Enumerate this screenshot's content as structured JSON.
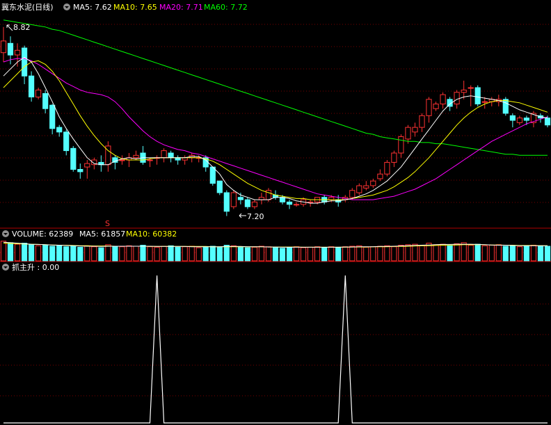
{
  "header": {
    "title": "冀东水泥(日线)",
    "ma5_label": "MA5: 7.62",
    "ma10_label": "MA10: 7.65",
    "ma20_label": "MA20: 7.71",
    "ma60_label": "MA60: 7.72"
  },
  "volume_header": {
    "volume_label": "VOLUME: 62389",
    "ma5_label": "MA5: 61857",
    "ma10_label": "MA10: 60382"
  },
  "indicator_header": {
    "label": "抓主升 : 0.00"
  },
  "annotations": {
    "high": "8.82",
    "low": "7.20",
    "marker": "S"
  },
  "colors": {
    "background": "#000000",
    "up": "#ff3232",
    "down": "#54ffff",
    "ma5": "#ffffff",
    "ma10": "#ffff00",
    "ma20": "#ff00ff",
    "ma60": "#00ff00",
    "grid": "#7a0000",
    "separator": "#b00000",
    "indicator": "#ffffff",
    "marker": "#ff3232"
  },
  "chart_data": [
    {
      "type": "candlestick",
      "title": "冀东水泥(日线)",
      "ylim": [
        7.12,
        8.92
      ],
      "grid": true,
      "candles": [
        [
          8.6,
          8.7,
          8.52,
          8.82
        ],
        [
          8.68,
          8.58,
          8.5,
          8.74
        ],
        [
          8.58,
          8.62,
          8.48,
          8.68
        ],
        [
          8.64,
          8.4,
          8.33,
          8.66
        ],
        [
          8.4,
          8.22,
          8.18,
          8.44
        ],
        [
          8.22,
          8.28,
          8.2,
          8.3
        ],
        [
          8.25,
          8.12,
          8.08,
          8.28
        ],
        [
          8.15,
          7.95,
          7.9,
          8.16
        ],
        [
          7.96,
          7.92,
          7.88,
          7.98
        ],
        [
          7.92,
          7.76,
          7.72,
          7.94
        ],
        [
          7.78,
          7.6,
          7.58,
          7.8
        ],
        [
          7.6,
          7.58,
          7.52,
          7.65
        ],
        [
          7.62,
          7.65,
          7.52,
          7.68
        ],
        [
          7.64,
          7.68,
          7.6,
          7.7
        ],
        [
          7.66,
          7.64,
          7.58,
          7.72
        ],
        [
          7.64,
          7.8,
          7.58,
          7.84
        ],
        [
          7.7,
          7.66,
          7.6,
          7.72
        ],
        [
          7.68,
          7.68,
          7.64,
          7.72
        ],
        [
          7.68,
          7.7,
          7.62,
          7.74
        ],
        [
          7.7,
          7.72,
          7.68,
          7.76
        ],
        [
          7.74,
          7.66,
          7.64,
          7.8
        ],
        [
          7.68,
          7.68,
          7.62,
          7.7
        ],
        [
          7.7,
          7.7,
          7.64,
          7.72
        ],
        [
          7.7,
          7.76,
          7.66,
          7.78
        ],
        [
          7.74,
          7.7,
          7.66,
          7.76
        ],
        [
          7.7,
          7.68,
          7.64,
          7.72
        ],
        [
          7.68,
          7.7,
          7.64,
          7.72
        ],
        [
          7.7,
          7.72,
          7.66,
          7.74
        ],
        [
          7.7,
          7.7,
          7.66,
          7.72
        ],
        [
          7.7,
          7.62,
          7.58,
          7.72
        ],
        [
          7.62,
          7.48,
          7.46,
          7.62
        ],
        [
          7.5,
          7.4,
          7.38,
          7.5
        ],
        [
          7.4,
          7.24,
          7.2,
          7.42
        ],
        [
          7.28,
          7.4,
          7.26,
          7.42
        ],
        [
          7.36,
          7.34,
          7.3,
          7.4
        ],
        [
          7.34,
          7.28,
          7.26,
          7.36
        ],
        [
          7.28,
          7.32,
          7.26,
          7.34
        ],
        [
          7.34,
          7.36,
          7.3,
          7.4
        ],
        [
          7.34,
          7.42,
          7.32,
          7.44
        ],
        [
          7.38,
          7.36,
          7.34,
          7.42
        ],
        [
          7.36,
          7.32,
          7.3,
          7.38
        ],
        [
          7.32,
          7.3,
          7.26,
          7.34
        ],
        [
          7.3,
          7.3,
          7.28,
          7.32
        ],
        [
          7.3,
          7.34,
          7.28,
          7.36
        ],
        [
          7.32,
          7.32,
          7.28,
          7.34
        ],
        [
          7.32,
          7.36,
          7.3,
          7.36
        ],
        [
          7.36,
          7.32,
          7.3,
          7.38
        ],
        [
          7.34,
          7.36,
          7.32,
          7.38
        ],
        [
          7.34,
          7.32,
          7.28,
          7.38
        ],
        [
          7.34,
          7.36,
          7.32,
          7.38
        ],
        [
          7.36,
          7.42,
          7.34,
          7.44
        ],
        [
          7.4,
          7.46,
          7.38,
          7.48
        ],
        [
          7.44,
          7.46,
          7.42,
          7.5
        ],
        [
          7.46,
          7.5,
          7.44,
          7.52
        ],
        [
          7.52,
          7.56,
          7.5,
          7.6
        ],
        [
          7.56,
          7.66,
          7.54,
          7.68
        ],
        [
          7.66,
          7.74,
          7.62,
          7.76
        ],
        [
          7.74,
          7.88,
          7.7,
          7.9
        ],
        [
          7.86,
          7.96,
          7.82,
          7.98
        ],
        [
          7.92,
          7.96,
          7.88,
          8.0
        ],
        [
          7.96,
          8.06,
          7.92,
          8.08
        ],
        [
          8.06,
          8.2,
          8.0,
          8.22
        ],
        [
          8.12,
          8.16,
          8.1,
          8.18
        ],
        [
          8.16,
          8.24,
          8.12,
          8.26
        ],
        [
          8.2,
          8.14,
          8.1,
          8.22
        ],
        [
          8.16,
          8.26,
          8.12,
          8.28
        ],
        [
          8.26,
          8.28,
          8.2,
          8.36
        ],
        [
          8.3,
          8.3,
          8.14,
          8.32
        ],
        [
          8.3,
          8.16,
          8.14,
          8.32
        ],
        [
          8.18,
          8.18,
          8.12,
          8.22
        ],
        [
          8.18,
          8.2,
          8.14,
          8.22
        ],
        [
          8.18,
          8.2,
          8.14,
          8.24
        ],
        [
          8.2,
          8.08,
          8.06,
          8.22
        ],
        [
          8.06,
          8.02,
          7.96,
          8.08
        ],
        [
          8.0,
          8.04,
          7.98,
          8.06
        ],
        [
          8.04,
          8.02,
          7.98,
          8.06
        ],
        [
          8.0,
          8.08,
          7.96,
          8.1
        ],
        [
          8.06,
          8.04,
          8.0,
          8.08
        ],
        [
          8.04,
          7.98,
          7.96,
          8.06
        ]
      ],
      "ma_lines": {
        "ma5": [
          8.4,
          8.46,
          8.52,
          8.56,
          8.52,
          8.42,
          8.3,
          8.18,
          8.05,
          7.95,
          7.86,
          7.78,
          7.7,
          7.65,
          7.64,
          7.64,
          7.67,
          7.69,
          7.7,
          7.69,
          7.7,
          7.7,
          7.7,
          7.7,
          7.7,
          7.7,
          7.7,
          7.71,
          7.71,
          7.68,
          7.62,
          7.56,
          7.47,
          7.42,
          7.38,
          7.36,
          7.34,
          7.34,
          7.34,
          7.36,
          7.36,
          7.35,
          7.33,
          7.32,
          7.31,
          7.31,
          7.32,
          7.33,
          7.33,
          7.34,
          7.35,
          7.37,
          7.39,
          7.42,
          7.46,
          7.5,
          7.56,
          7.62,
          7.7,
          7.78,
          7.86,
          7.94,
          8.02,
          8.1,
          8.16,
          8.2,
          8.22,
          8.23,
          8.22,
          8.21,
          8.2,
          8.19,
          8.17,
          8.14,
          8.11,
          8.09,
          8.07,
          8.05,
          8.04
        ],
        "ma10": [
          8.3,
          8.36,
          8.42,
          8.48,
          8.52,
          8.53,
          8.5,
          8.44,
          8.36,
          8.26,
          8.16,
          8.06,
          7.97,
          7.89,
          7.82,
          7.76,
          7.72,
          7.69,
          7.68,
          7.68,
          7.68,
          7.69,
          7.7,
          7.7,
          7.7,
          7.7,
          7.7,
          7.7,
          7.7,
          7.69,
          7.67,
          7.64,
          7.6,
          7.56,
          7.52,
          7.48,
          7.45,
          7.42,
          7.4,
          7.38,
          7.37,
          7.36,
          7.35,
          7.35,
          7.34,
          7.34,
          7.34,
          7.34,
          7.34,
          7.34,
          7.35,
          7.36,
          7.37,
          7.38,
          7.4,
          7.42,
          7.45,
          7.49,
          7.53,
          7.58,
          7.64,
          7.7,
          7.77,
          7.84,
          7.91,
          7.98,
          8.04,
          8.09,
          8.13,
          8.16,
          8.18,
          8.19,
          8.19,
          8.18,
          8.17,
          8.15,
          8.13,
          8.11,
          8.09
        ],
        "ma20": [
          8.52,
          8.54,
          8.55,
          8.55,
          8.53,
          8.5,
          8.46,
          8.42,
          8.38,
          8.34,
          8.31,
          8.28,
          8.26,
          8.25,
          8.24,
          8.22,
          8.18,
          8.12,
          8.05,
          7.99,
          7.93,
          7.88,
          7.84,
          7.81,
          7.79,
          7.77,
          7.76,
          7.74,
          7.73,
          7.71,
          7.69,
          7.67,
          7.65,
          7.63,
          7.61,
          7.59,
          7.57,
          7.55,
          7.53,
          7.51,
          7.49,
          7.47,
          7.45,
          7.43,
          7.41,
          7.39,
          7.38,
          7.37,
          7.36,
          7.35,
          7.34,
          7.34,
          7.34,
          7.34,
          7.35,
          7.36,
          7.37,
          7.39,
          7.41,
          7.43,
          7.46,
          7.49,
          7.52,
          7.56,
          7.6,
          7.64,
          7.68,
          7.72,
          7.76,
          7.8,
          7.84,
          7.87,
          7.9,
          7.93,
          7.96,
          7.99,
          8.01,
          8.03,
          8.05
        ],
        "ma60": [
          8.88,
          8.87,
          8.86,
          8.85,
          8.84,
          8.83,
          8.82,
          8.8,
          8.79,
          8.77,
          8.75,
          8.73,
          8.71,
          8.69,
          8.67,
          8.65,
          8.63,
          8.61,
          8.59,
          8.57,
          8.55,
          8.53,
          8.51,
          8.49,
          8.47,
          8.45,
          8.43,
          8.41,
          8.39,
          8.37,
          8.35,
          8.33,
          8.31,
          8.29,
          8.27,
          8.25,
          8.23,
          8.21,
          8.19,
          8.17,
          8.15,
          8.13,
          8.11,
          8.09,
          8.07,
          8.05,
          8.03,
          8.01,
          7.99,
          7.97,
          7.95,
          7.93,
          7.91,
          7.9,
          7.88,
          7.87,
          7.86,
          7.85,
          7.84,
          7.84,
          7.83,
          7.83,
          7.82,
          7.82,
          7.81,
          7.8,
          7.79,
          7.78,
          7.77,
          7.76,
          7.75,
          7.74,
          7.73,
          7.73,
          7.72,
          7.72,
          7.72,
          7.72,
          7.72
        ]
      }
    },
    {
      "type": "bar",
      "title": "VOLUME: 62389",
      "ylim": [
        0,
        80000
      ],
      "values": [
        78000,
        72000,
        66000,
        70000,
        64000,
        60000,
        62000,
        58000,
        60000,
        56000,
        58000,
        54000,
        60000,
        56000,
        52000,
        64000,
        58000,
        56000,
        60000,
        58000,
        62000,
        56000,
        54000,
        58000,
        60000,
        54000,
        56000,
        58000,
        52000,
        56000,
        58000,
        54000,
        62000,
        60000,
        56000,
        52000,
        54000,
        58000,
        56000,
        52000,
        50000,
        54000,
        56000,
        52000,
        54000,
        56000,
        52000,
        56000,
        54000,
        56000,
        58000,
        60000,
        54000,
        56000,
        58000,
        60000,
        56000,
        62000,
        64000,
        66000,
        60000,
        70000,
        64000,
        66000,
        60000,
        68000,
        72000,
        62000,
        66000,
        60000,
        62000,
        64000,
        58000,
        60000,
        56000,
        58000,
        62000,
        60000,
        58000
      ],
      "ma_lines": {
        "ma5": [
          74000,
          72000,
          70000,
          68000,
          66000,
          65000,
          64000,
          63000,
          62000,
          61000,
          60000,
          59000,
          58000,
          58000,
          57000,
          58000,
          58000,
          58000,
          58000,
          58000,
          58000,
          58000,
          57000,
          57000,
          57000,
          57000,
          57000,
          56000,
          56000,
          56000,
          56000,
          56000,
          57000,
          57000,
          57000,
          56000,
          56000,
          56000,
          55000,
          55000,
          54000,
          54000,
          54000,
          54000,
          54000,
          54000,
          54000,
          54000,
          54000,
          55000,
          55000,
          56000,
          56000,
          56000,
          57000,
          57000,
          58000,
          59000,
          60000,
          61000,
          62000,
          63000,
          64000,
          65000,
          65000,
          66000,
          66000,
          66000,
          65000,
          64000,
          63000,
          62000,
          62000,
          61000,
          60000,
          60000,
          60000,
          60000,
          60000
        ],
        "ma10": [
          70000,
          69000,
          68000,
          67000,
          66000,
          65000,
          64000,
          63000,
          62000,
          62000,
          61000,
          60000,
          60000,
          59000,
          59000,
          59000,
          58000,
          58000,
          58000,
          58000,
          58000,
          57000,
          57000,
          57000,
          57000,
          57000,
          57000,
          57000,
          57000,
          57000,
          56000,
          56000,
          56000,
          56000,
          56000,
          56000,
          56000,
          56000,
          55000,
          55000,
          55000,
          55000,
          55000,
          54000,
          54000,
          54000,
          54000,
          54000,
          54000,
          54000,
          55000,
          55000,
          55000,
          56000,
          56000,
          56000,
          57000,
          57000,
          58000,
          59000,
          60000,
          60000,
          61000,
          62000,
          63000,
          63000,
          64000,
          64000,
          64000,
          64000,
          63000,
          63000,
          62000,
          62000,
          61000,
          61000,
          61000,
          60000,
          60000
        ]
      }
    },
    {
      "type": "line",
      "title": "抓主升 : 0.00",
      "ylim": [
        0,
        1
      ],
      "values": [
        0,
        0,
        0,
        0,
        0,
        0,
        0,
        0,
        0,
        0,
        0,
        0,
        0,
        0,
        0,
        0,
        0,
        0,
        0,
        0,
        0,
        0,
        1,
        0,
        0,
        0,
        0,
        0,
        0,
        0,
        0,
        0,
        0,
        0,
        0,
        0,
        0,
        0,
        0,
        0,
        0,
        0,
        0,
        0,
        0,
        0,
        0,
        0,
        0,
        1,
        0,
        0,
        0,
        0,
        0,
        0,
        0,
        0,
        0,
        0,
        0,
        0,
        0,
        0,
        0,
        0,
        0,
        0,
        0,
        0,
        0,
        0,
        0,
        0,
        0,
        0,
        0,
        0,
        0
      ]
    }
  ]
}
